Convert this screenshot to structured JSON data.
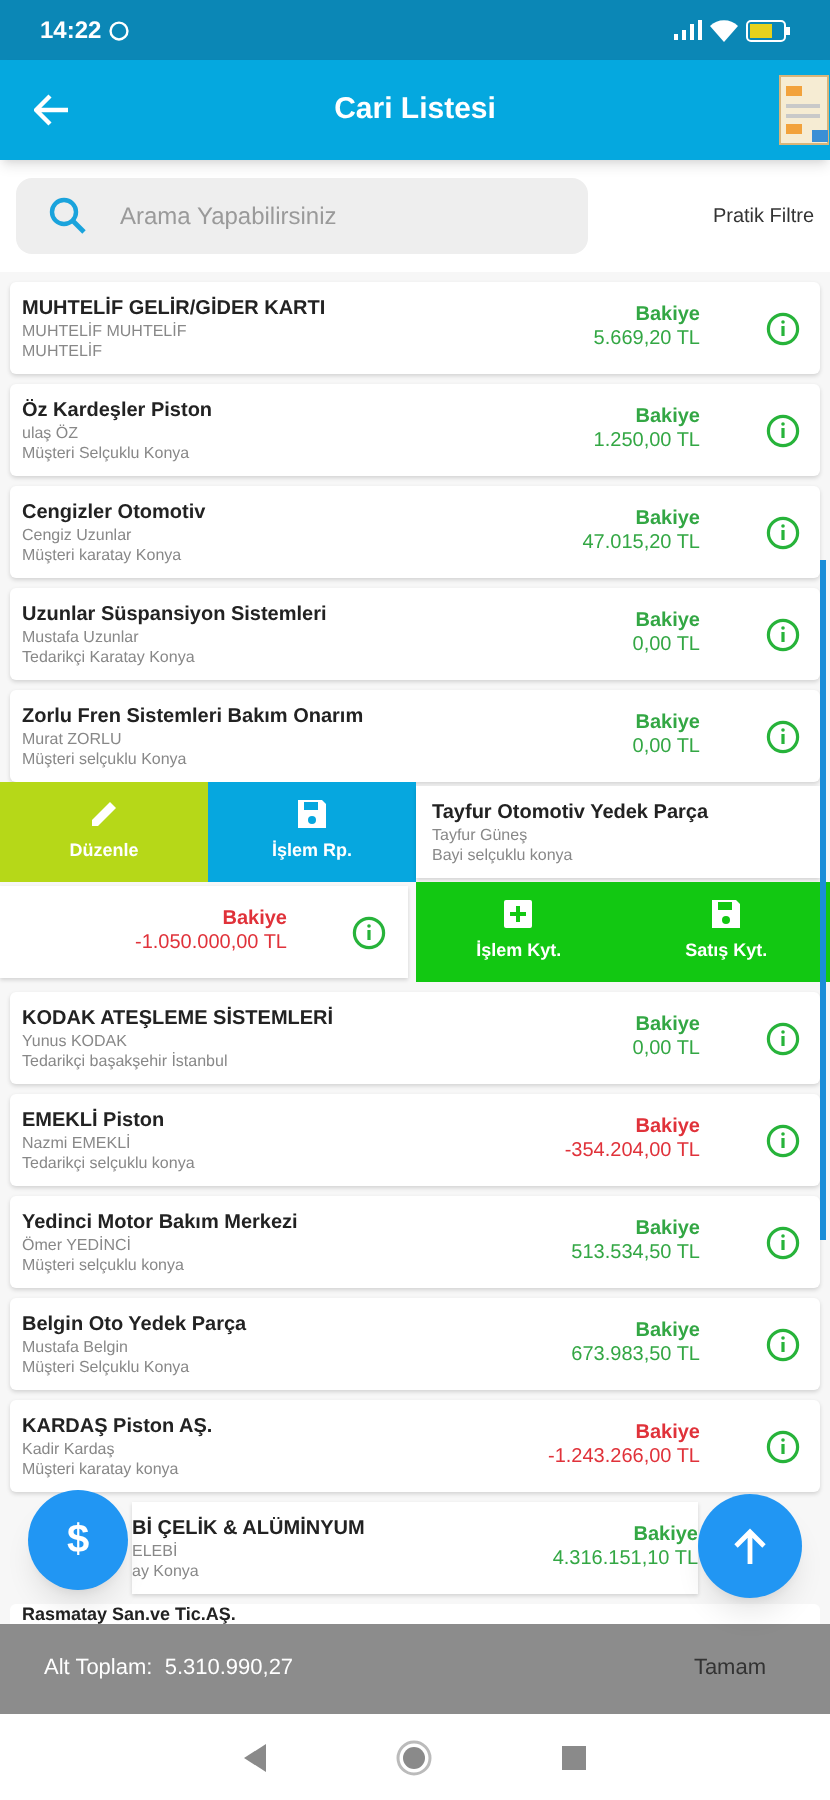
{
  "status_bar": {
    "time": "14:22"
  },
  "app_bar": {
    "title": "Cari Listesi"
  },
  "search": {
    "placeholder": "Arama Yapabilirsiniz"
  },
  "filter_button": {
    "label": "Pratik Filtre"
  },
  "accounts": [
    {
      "kind": "card",
      "name": "MUHTELİF GELİR/GİDER KARTI",
      "contact": "MUHTELİF MUHTELİF",
      "location": "MUHTELİF",
      "balance_label": "Bakiye",
      "balance": "5.669,20 TL",
      "negative": false
    },
    {
      "kind": "card",
      "name": "Öz Kardeşler Piston",
      "contact": "ulaş ÖZ",
      "location": "Müşteri Selçuklu Konya",
      "balance_label": "Bakiye",
      "balance": "1.250,00 TL",
      "negative": false
    },
    {
      "kind": "card",
      "name": "Cengizler Otomotiv",
      "contact": "Cengiz Uzunlar",
      "location": "Müşteri karatay Konya",
      "balance_label": "Bakiye",
      "balance": "47.015,20 TL",
      "negative": false
    },
    {
      "kind": "card",
      "name": "Uzunlar Süspansiyon Sistemleri",
      "contact": "Mustafa Uzunlar",
      "location": "Tedarikçi Karatay Konya",
      "balance_label": "Bakiye",
      "balance": "0,00 TL",
      "negative": false
    },
    {
      "kind": "card",
      "name": "Zorlu Fren Sistemleri Bakım Onarım",
      "contact": "Murat ZORLU",
      "location": "Müşteri selçuklu Konya",
      "balance_label": "Bakiye",
      "balance": "0,00 TL",
      "negative": false
    },
    {
      "kind": "swiped_right",
      "name": "Tayfur Otomotiv Yedek Parça",
      "contact": "Tayfur Güneş",
      "location": "Bayi selçuklu konya",
      "actions": [
        {
          "kind": "edit",
          "label": "Düzenle"
        },
        {
          "kind": "save",
          "label": "İşlem Rp."
        }
      ]
    },
    {
      "kind": "swiped_left",
      "balance_label": "Bakiye",
      "balance": "-1.050.000,00 TL",
      "negative": true,
      "actions": [
        {
          "kind": "add",
          "label": "İşlem Kyt."
        },
        {
          "kind": "save",
          "label": "Satış Kyt."
        }
      ]
    },
    {
      "kind": "card",
      "name": "KODAK ATEŞLEME SİSTEMLERİ",
      "contact": "Yunus KODAK",
      "location": "Tedarikçi başakşehir İstanbul",
      "balance_label": "Bakiye",
      "balance": "0,00 TL",
      "negative": false
    },
    {
      "kind": "card",
      "name": "EMEKLİ Piston",
      "contact": "Nazmi EMEKLİ",
      "location": "Tedarikçi selçuklu konya",
      "balance_label": "Bakiye",
      "balance": "-354.204,00 TL",
      "negative": true
    },
    {
      "kind": "card",
      "name": "Yedinci Motor Bakım Merkezi",
      "contact": "Ömer YEDİNCİ",
      "location": "Müşteri selçuklu konya",
      "balance_label": "Bakiye",
      "balance": "513.534,50 TL",
      "negative": false
    },
    {
      "kind": "card",
      "name": "Belgin Oto Yedek Parça",
      "contact": "Mustafa Belgin",
      "location": "Müşteri Selçuklu Konya",
      "balance_label": "Bakiye",
      "balance": "673.983,50 TL",
      "negative": false
    },
    {
      "kind": "card",
      "name": "KARDAŞ Piston AŞ.",
      "contact": "Kadir Kardaş",
      "location": "Müşteri karatay konya",
      "balance_label": "Bakiye",
      "balance": "-1.243.266,00 TL",
      "negative": true
    },
    {
      "kind": "covered",
      "name": "Bİ ÇELİK & ALÜMİNYUM",
      "contact": "ELEBİ",
      "location": "ay Konya",
      "balance_label": "Bakiye",
      "balance": "4.316.151,10 TL",
      "negative": false
    },
    {
      "kind": "cut",
      "name": "Rasmatay San.ve Tic.AŞ."
    }
  ],
  "money_button": {
    "symbol": "$"
  },
  "footer": {
    "subtotal": "Alt Toplam:  5.310.990,27",
    "done": "Tamam"
  }
}
